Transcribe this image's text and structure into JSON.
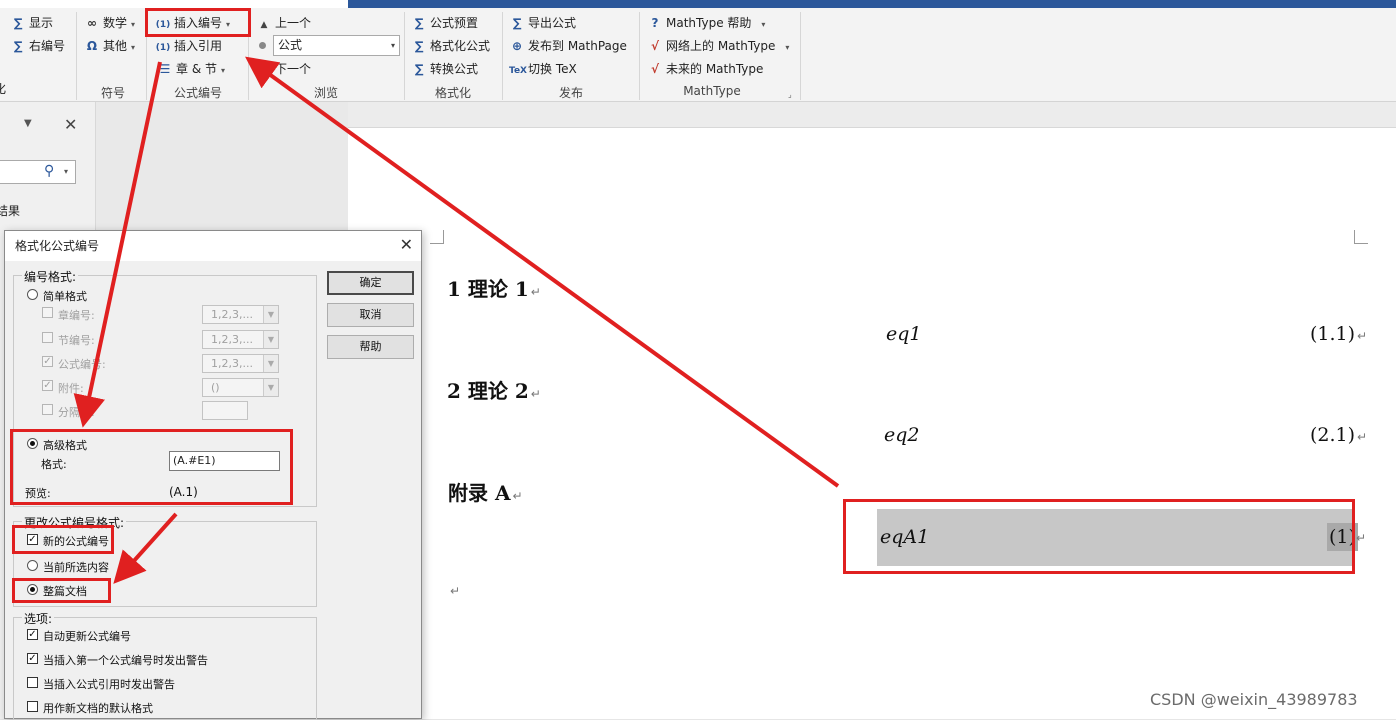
{
  "ribbon": {
    "groups": {
      "symbols": "符号",
      "equation_numbers": "公式编号",
      "browse": "浏览",
      "format": "格式化",
      "publish": "发布",
      "mathtype": "MathType"
    },
    "buttons": {
      "show": "显示",
      "right_number": "右编号",
      "math": "数学",
      "other": "其他",
      "insert_number": "插入编号",
      "insert_reference": "插入引用",
      "chapter_section": "章 & 节",
      "previous": "上一个",
      "next": "下一个",
      "browse_combo": "公式",
      "equation_preset": "公式预置",
      "format_equations": "格式化公式",
      "convert_equations": "转换公式",
      "export_equations": "导出公式",
      "publish_mathpage": "发布到 MathPage",
      "toggle_tex": "切换 TeX",
      "mathtype_help": "MathType 帮助",
      "mathtype_online": "网络上的 MathType",
      "mathtype_future": "未来的 MathType"
    }
  },
  "nav": {
    "results_partial": "结果",
    "left_char": "化"
  },
  "dialog": {
    "title": "格式化公式编号",
    "format_group": "编号格式:",
    "simple_format": "简单格式",
    "chapter_number": "章编号:",
    "section_number": "节编号:",
    "equation_number": "公式编号:",
    "enclosure": "附件:",
    "separator": "分隔符:",
    "numbering_value": "1,2,3,...",
    "enclosure_value": "()",
    "advanced_format": "高级格式",
    "format_label": "格式:",
    "format_value": "(A.#E1)",
    "preview_label": "预览:",
    "preview_value": "(A.1)",
    "change_group": "更改公式编号格式:",
    "new_numbers": "新的公式编号",
    "current_selection": "当前所选内容",
    "whole_document": "整篇文档",
    "options_group": "选项:",
    "auto_update": "自动更新公式编号",
    "warn_first": "当插入第一个公式编号时发出警告",
    "warn_reference": "当插入公式引用时发出警告",
    "use_default": "用作新文档的默认格式",
    "ok": "确定",
    "cancel": "取消",
    "help": "帮助"
  },
  "document": {
    "heading1": "1  理论 1",
    "eq1": "eq1",
    "num1": "(1.1)",
    "heading2": "2  理论 2",
    "eq2": "eq2",
    "num2": "(2.1)",
    "appendix": "附录 A",
    "eq3": "eqA1",
    "num3": "(1)",
    "paragraph_mark": "↵"
  },
  "watermark": "CSDN @weixin_43989783",
  "colors": {
    "ribbon_blue": "#2b579a",
    "annotation_red": "#e02020",
    "highlight_gray": "#c7c7c7"
  }
}
